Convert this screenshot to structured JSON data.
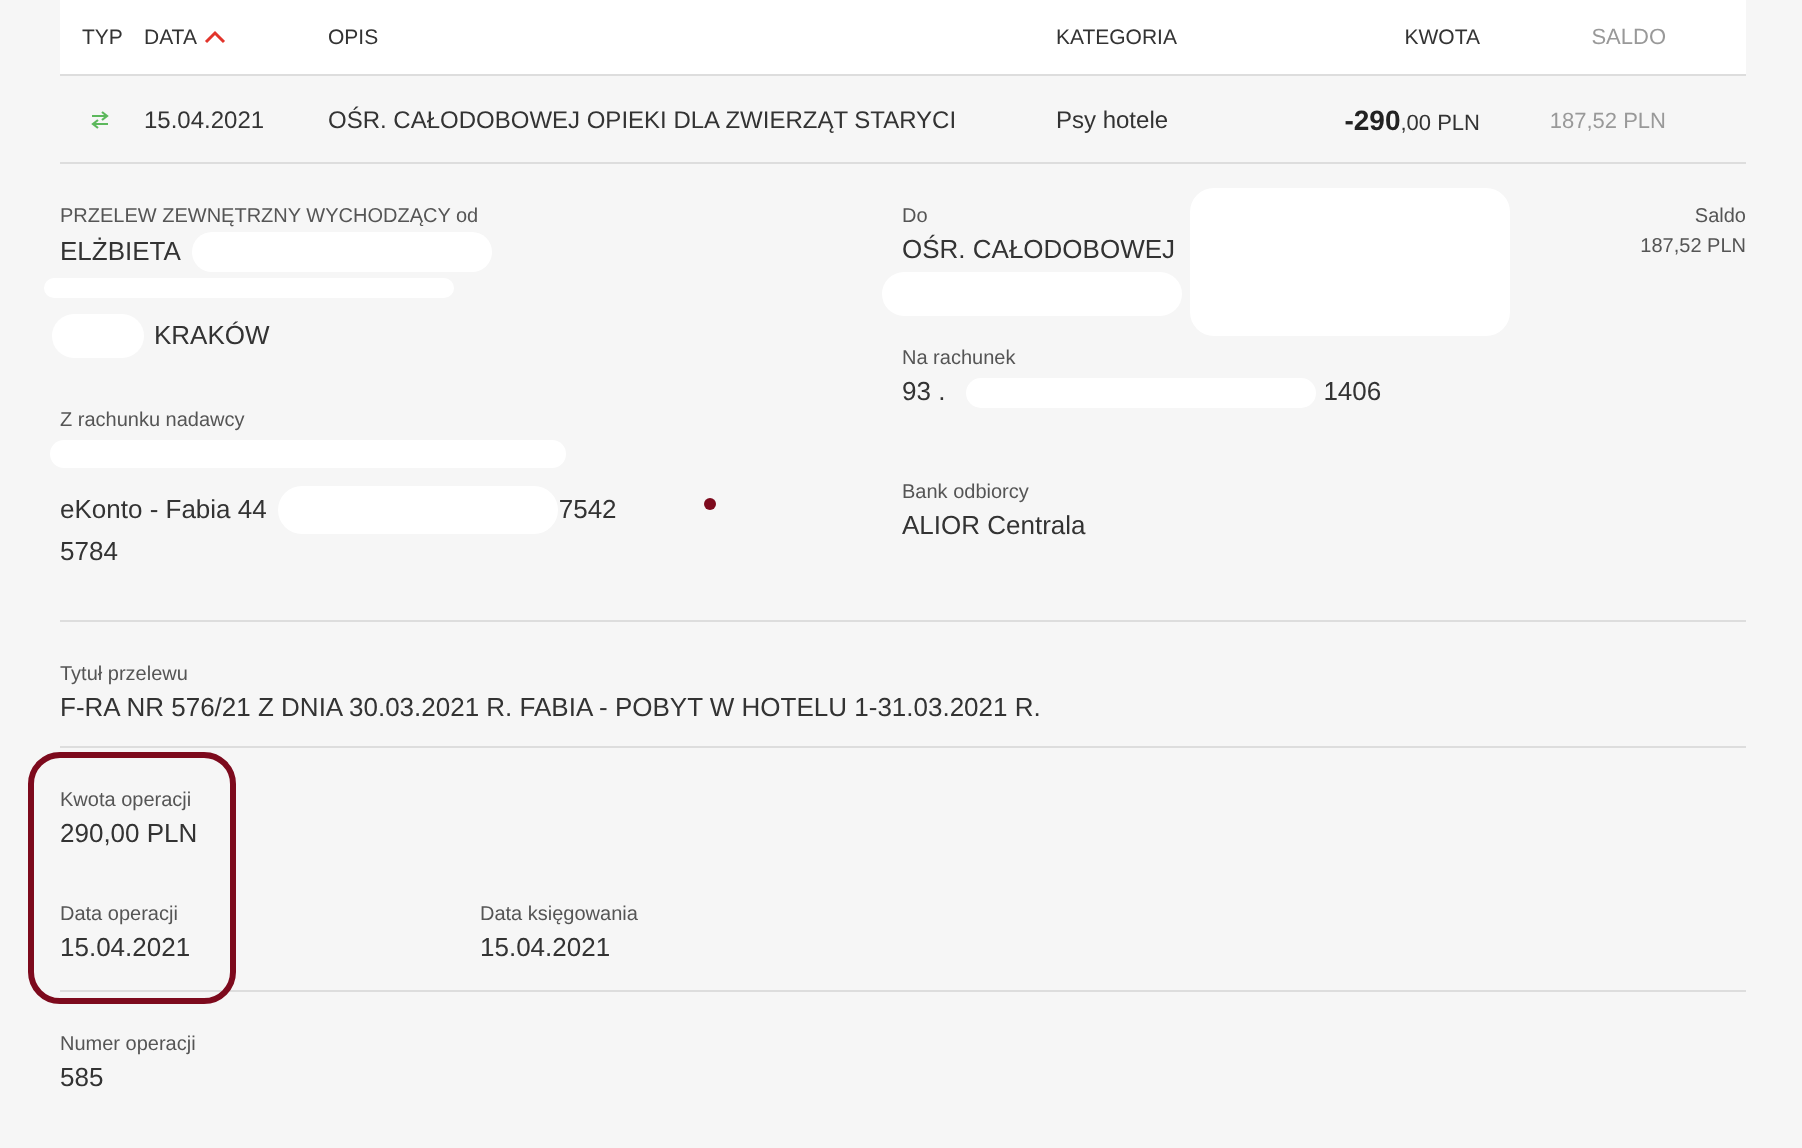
{
  "columns": [
    {
      "label": "TYP",
      "sorted": false
    },
    {
      "label": "DATA",
      "sorted": true
    },
    {
      "label": "OPIS",
      "sorted": false
    },
    {
      "label": "KATEGORIA",
      "sorted": false
    },
    {
      "label": "KWOTA",
      "sorted": false
    },
    {
      "label": "SALDO",
      "sorted": false
    }
  ],
  "transaction": {
    "date": "15.04.2021",
    "description": "OŚR. CAŁODOBOWEJ OPIEKI DLA ZWIERZĄT STARYCI",
    "category": "Psy hotele",
    "amount_whole": "-290",
    "amount_rest": ",00 PLN",
    "balance": "187,52 PLN"
  },
  "details": {
    "sender_label": "PRZELEW ZEWNĘTRZNY WYCHODZĄCY od",
    "sender_name": "ELŻBIETA",
    "sender_city": "KRAKÓW",
    "sender_account_label": "Z rachunku nadawcy",
    "sender_account_name": "eKonto - Fabia 44",
    "sender_account_end": "7542",
    "sender_account_line2": "5784",
    "recipient_label": "Do",
    "recipient_name": "OŚR. CAŁODOBOWEJ",
    "recipient_account_label": "Na rachunek",
    "recipient_account_start": "93 .",
    "recipient_account_end": "1406",
    "bank_label": "Bank odbiorcy",
    "bank_name": "ALIOR Centrala",
    "balance_label": "Saldo",
    "balance_value": "187,52 PLN",
    "title_label": "Tytuł przelewu",
    "title_value": "F-RA NR 576/21 Z DNIA 30.03.2021 R. FABIA - POBYT W HOTELU 1-31.03.2021 R.",
    "amount_label": "Kwota operacji",
    "amount_value": "290,00 PLN",
    "op_date_label": "Data operacji",
    "op_date_value": "15.04.2021",
    "book_date_label": "Data księgowania",
    "book_date_value": "15.04.2021",
    "number_label": "Numer operacji",
    "number_value": "585"
  }
}
